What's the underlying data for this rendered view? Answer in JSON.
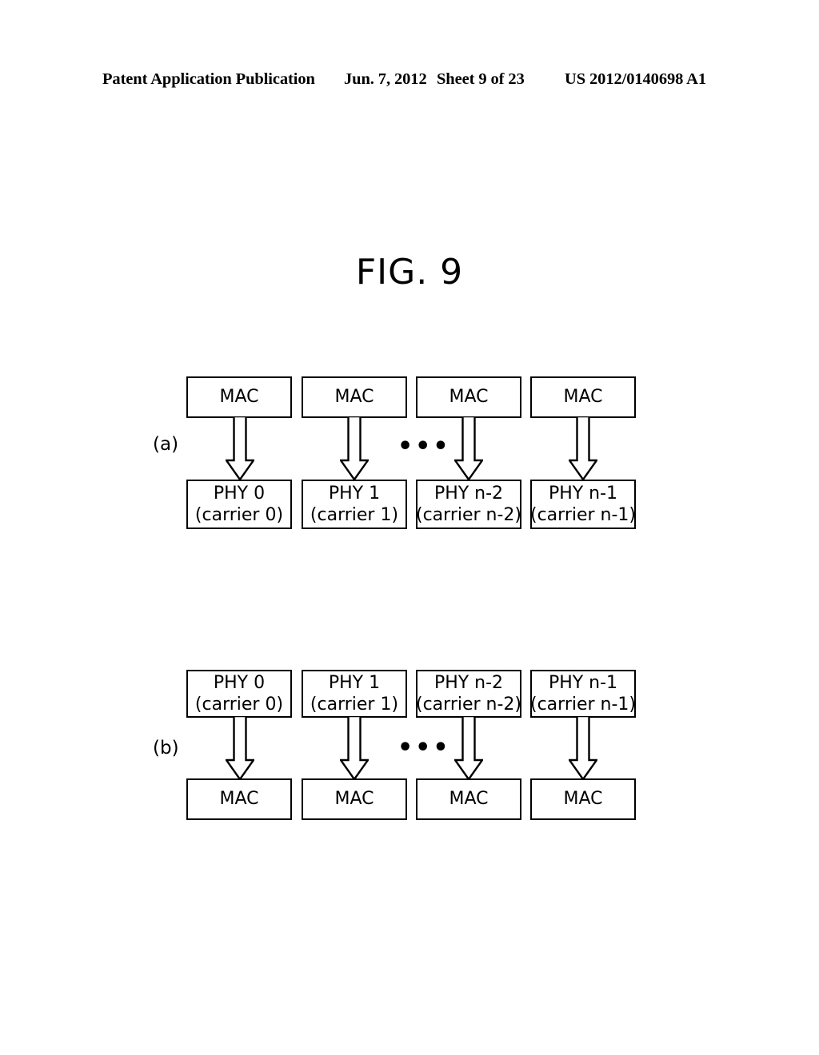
{
  "header": {
    "publication": "Patent Application Publication",
    "date": "Jun. 7, 2012",
    "sheet": "Sheet 9 of 23",
    "patent_number": "US 2012/0140698 A1"
  },
  "figure": {
    "title": "FIG. 9",
    "ellipsis": "•••",
    "colors": {
      "stroke": "#000000",
      "fill": "#ffffff",
      "background": "#ffffff"
    },
    "sections": [
      {
        "label": "(a)",
        "direction": "mac-to-phy",
        "top_row": [
          {
            "line1": "MAC",
            "line2": ""
          },
          {
            "line1": "MAC",
            "line2": ""
          },
          {
            "line1": "MAC",
            "line2": ""
          },
          {
            "line1": "MAC",
            "line2": ""
          }
        ],
        "bottom_row": [
          {
            "line1": "PHY 0",
            "line2": "(carrier 0)"
          },
          {
            "line1": "PHY 1",
            "line2": "(carrier 1)"
          },
          {
            "line1": "PHY n-2",
            "line2": "(carrier n-2)"
          },
          {
            "line1": "PHY n-1",
            "line2": "(carrier n-1)"
          }
        ],
        "arrows": [
          {
            "from": "MAC",
            "to": "PHY 0",
            "style": "hollow-block-down"
          },
          {
            "from": "MAC",
            "to": "PHY 1",
            "style": "hollow-block-down"
          },
          {
            "from": "MAC",
            "to": "PHY n-2",
            "style": "hollow-block-down"
          },
          {
            "from": "MAC",
            "to": "PHY n-1",
            "style": "hollow-block-down"
          }
        ]
      },
      {
        "label": "(b)",
        "direction": "phy-to-mac",
        "top_row": [
          {
            "line1": "PHY 0",
            "line2": "(carrier 0)"
          },
          {
            "line1": "PHY 1",
            "line2": "(carrier 1)"
          },
          {
            "line1": "PHY n-2",
            "line2": "(carrier n-2)"
          },
          {
            "line1": "PHY n-1",
            "line2": "(carrier n-1)"
          }
        ],
        "bottom_row": [
          {
            "line1": "MAC",
            "line2": ""
          },
          {
            "line1": "MAC",
            "line2": ""
          },
          {
            "line1": "MAC",
            "line2": ""
          },
          {
            "line1": "MAC",
            "line2": ""
          }
        ],
        "arrows": [
          {
            "from": "PHY 0",
            "to": "MAC",
            "style": "hollow-block-down"
          },
          {
            "from": "PHY 1",
            "to": "MAC",
            "style": "hollow-block-down"
          },
          {
            "from": "PHY n-2",
            "to": "MAC",
            "style": "hollow-block-down"
          },
          {
            "from": "PHY n-1",
            "to": "MAC",
            "style": "hollow-block-down"
          }
        ]
      }
    ]
  }
}
